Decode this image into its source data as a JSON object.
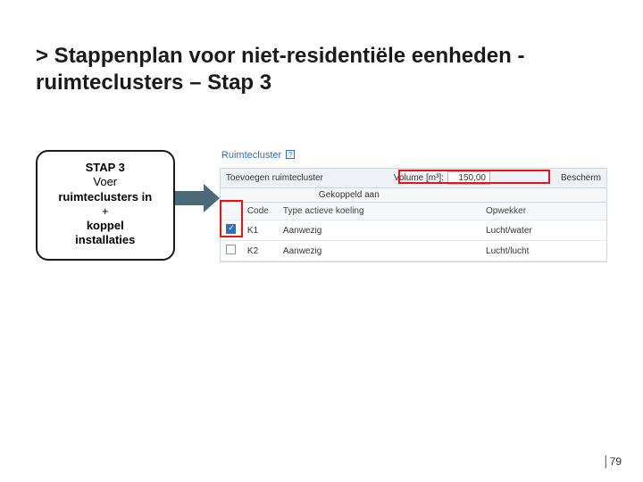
{
  "title": "> Stappenplan voor niet-residentiële eenheden - ruimteclusters – Stap 3",
  "step_box": {
    "label": "STAP 3",
    "line1": "Voer",
    "line2": "ruimteclusters in",
    "line3": "+",
    "line4": "koppel",
    "line5": "installaties"
  },
  "screenshot": {
    "breadcrumb": "Ruimtecluster",
    "breadcrumb_icon": "?",
    "panel_title": "Toevoegen ruimtecluster",
    "volume_label": "Volume [m³]:",
    "volume_value": "150,00",
    "beschermd_label": "Bescherm",
    "sub_label": "Gekoppeld aan",
    "columns": {
      "chk": "",
      "code": "Code",
      "type": "Type actieve koeling",
      "opwekker": "Opwekker"
    },
    "rows": [
      {
        "checked": true,
        "code": "K1",
        "type": "Aanwezig",
        "opwekker": "Lucht/water"
      },
      {
        "checked": false,
        "code": "K2",
        "type": "Aanwezig",
        "opwekker": "Lucht/lucht"
      }
    ]
  },
  "page_number": "│79"
}
